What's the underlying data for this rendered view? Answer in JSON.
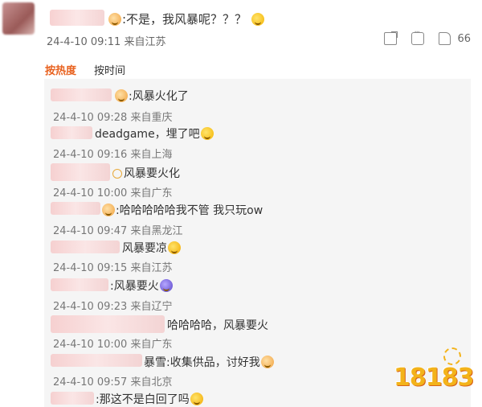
{
  "main_comment": {
    "text": ":不是，我风暴呢？？？",
    "meta": "24-4-10 09:11 来自江苏",
    "like_count": "66"
  },
  "tabs": [
    {
      "label": "按热度",
      "active": true
    },
    {
      "label": "按时间",
      "active": false
    }
  ],
  "replies": [
    {
      "text": ":风暴火化了",
      "meta": "24-4-10 09:28 来自重庆"
    },
    {
      "text": "deadgame，埋了吧",
      "meta": "24-4-10 09:16 来自上海"
    },
    {
      "text": "风暴要火化",
      "meta": "24-4-10 10:00 来自广东"
    },
    {
      "text": ":哈哈哈哈哈我不管 我只玩ow",
      "meta": "24-4-10 09:47 来自黑龙江"
    },
    {
      "text": "风暴要凉",
      "meta": "24-4-10 09:15 来自江苏"
    },
    {
      "text": ":风暴要火",
      "meta": "24-4-10 09:23 来自辽宁"
    },
    {
      "text": "哈哈哈哈，风暴要火",
      "meta": "24-4-10 10:00 来自广东"
    },
    {
      "text": "暴雪:收集供品，讨好我",
      "meta": "24-4-10 09:57 来自北京"
    },
    {
      "text": ":那这不是白回了吗",
      "meta": ""
    }
  ],
  "watermark": {
    "text": "18183"
  },
  "icons": {
    "share": "share-icon",
    "comment": "comment-icon",
    "like": "thumbs-up-icon"
  },
  "colors": {
    "accent": "#e8611e",
    "panel_bg": "#f5f5f5",
    "meta_text": "#777777"
  }
}
